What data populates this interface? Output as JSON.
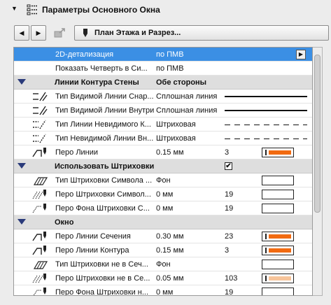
{
  "header": {
    "title": "Параметры Основного Окна"
  },
  "toolbar": {
    "view_label": "План Этажа и Разрез..."
  },
  "rows": {
    "r0": {
      "name": "2D-детализация",
      "value": "по ПМВ"
    },
    "r1": {
      "name": "Показать Четверть в Си...",
      "value": "по ПМВ"
    },
    "s1": {
      "name": "Линии Контура Стены",
      "value": "Обе стороны"
    },
    "r2": {
      "name": "Тип Видимой Линии Снар...",
      "value": "Сплошная линия"
    },
    "r3": {
      "name": "Тип Видимой Линии Внутри",
      "value": "Сплошная линия"
    },
    "r4": {
      "name": "Тип Линии Невидимого К...",
      "value": "Штриховая"
    },
    "r5": {
      "name": "Тип Невидимой Линии Вн...",
      "value": "Штриховая"
    },
    "r6": {
      "name": "Перо Линии",
      "value": "0.15 мм",
      "num": "3",
      "color": "#f26a10"
    },
    "s2": {
      "name": "Использовать Штриховки",
      "checked": "✔"
    },
    "r7": {
      "name": "Тип Штриховки Символа ...",
      "value": "Фон"
    },
    "r8": {
      "name": "Перо Штриховки Символ...",
      "value": "0 мм",
      "num": "19"
    },
    "r9": {
      "name": "Перо Фона Штриховки С...",
      "value": "0 мм",
      "num": "19"
    },
    "s3": {
      "name": "Окно"
    },
    "r10": {
      "name": "Перо Линии Сечения",
      "value": "0.30 мм",
      "num": "23",
      "color": "#f26a10"
    },
    "r11": {
      "name": "Перо Линии Контура",
      "value": "0.15 мм",
      "num": "3",
      "color": "#f26a10"
    },
    "r12": {
      "name": "Тип Штриховки не в Сеч...",
      "value": "Фон"
    },
    "r13": {
      "name": "Перо Штриховки не в Се...",
      "value": "0.05 мм",
      "num": "103",
      "color": "#f7c49a"
    },
    "r14": {
      "name": "Перо Фона Штриховки н...",
      "value": "0 мм",
      "num": "19"
    }
  },
  "colors": {
    "selection": "#3b8fe4",
    "section_bg": "#dedede",
    "section_triangle": "#2a3a7a"
  }
}
